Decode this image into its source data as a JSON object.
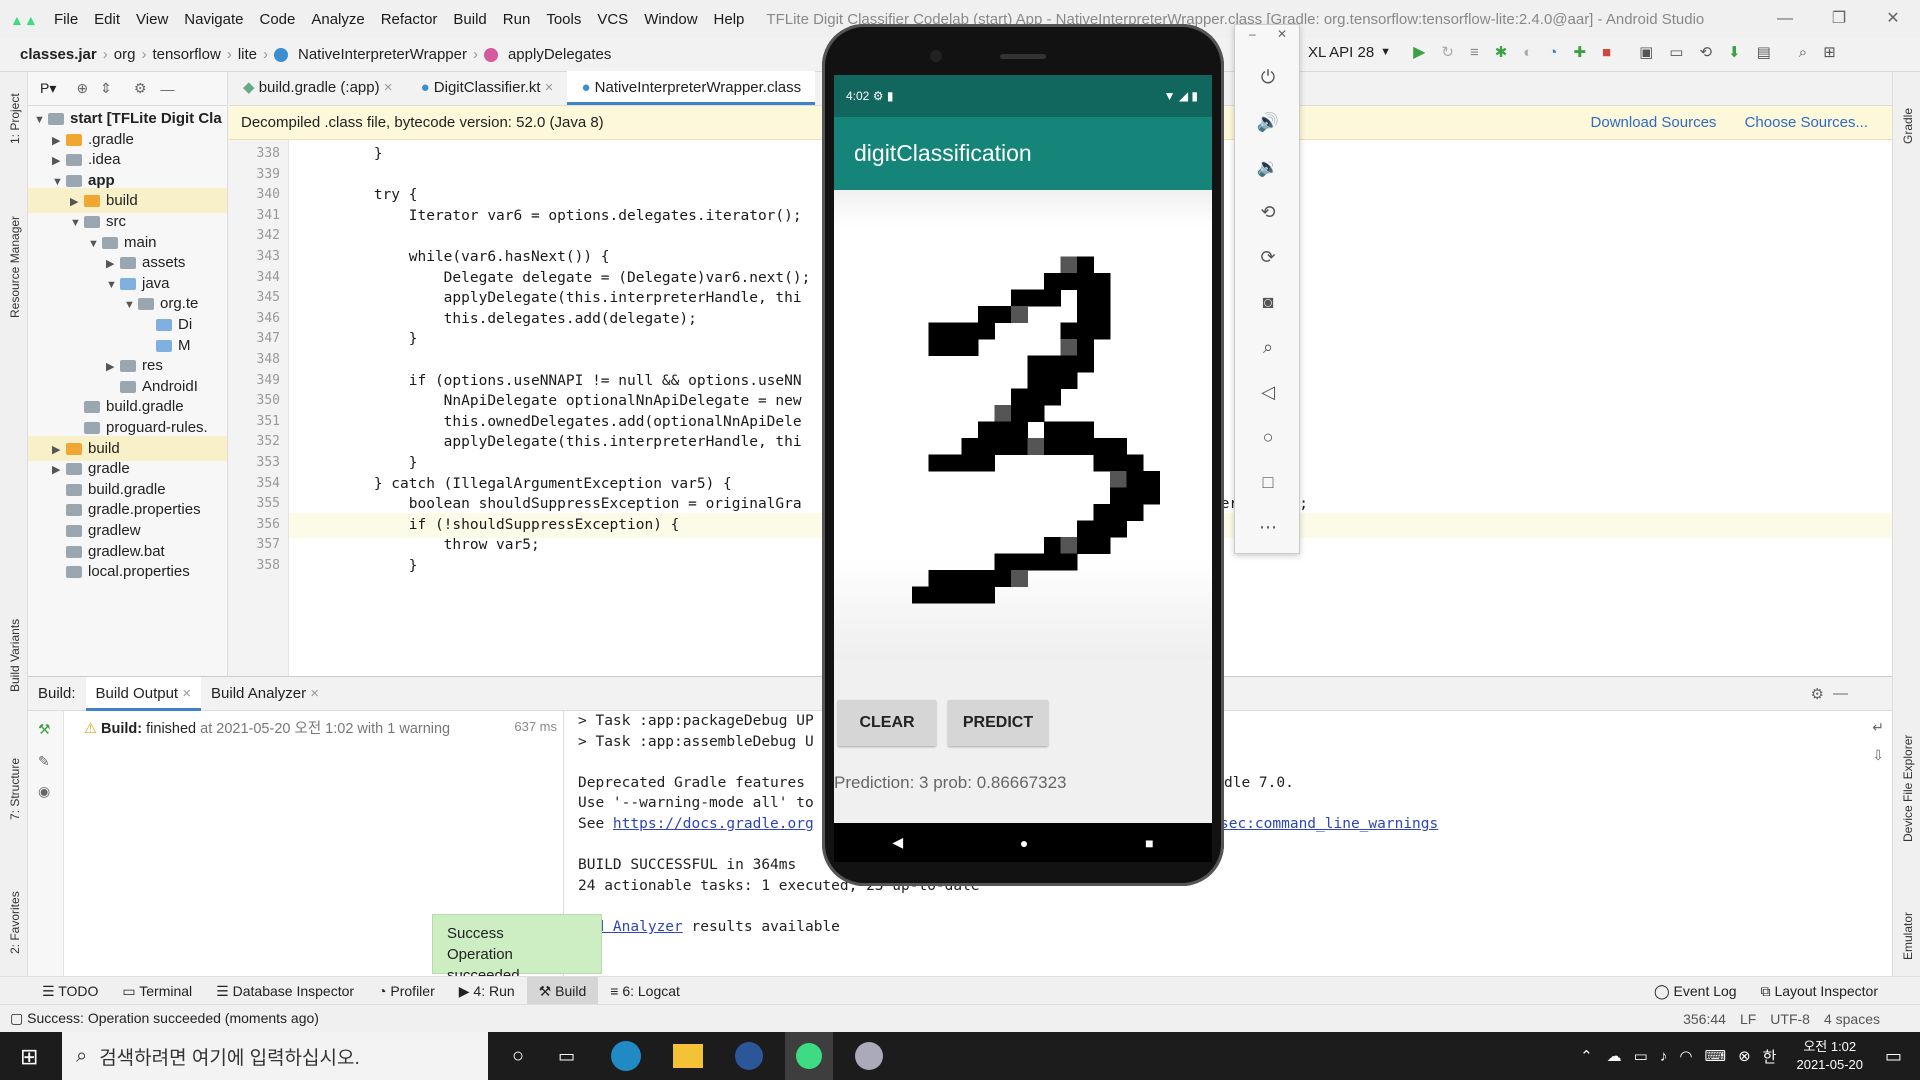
{
  "menu": [
    "File",
    "Edit",
    "View",
    "Navigate",
    "Code",
    "Analyze",
    "Refactor",
    "Build",
    "Run",
    "Tools",
    "VCS",
    "Window",
    "Help"
  ],
  "window_title": "TFLite Digit Classifier Codelab (start) App - NativeInterpreterWrapper.class [Gradle: org.tensorflow:tensorflow-lite:2.4.0@aar] - Android Studio",
  "breadcrumb": [
    "classes.jar",
    "org",
    "tensorflow",
    "lite",
    "NativeInterpreterWrapper",
    "applyDelegates"
  ],
  "device_selector": "XL API 28",
  "left_stripe": [
    "1: Project",
    "Resource Manager",
    "Build Variants",
    "7: Structure",
    "2: Favorites"
  ],
  "right_stripe": [
    "Gradle",
    "Device File Explorer",
    "Emulator"
  ],
  "project": {
    "header": "P▾",
    "items": [
      {
        "label": "start [TFLite Digit Cla",
        "depth": 0,
        "arrow": "▼",
        "icon": "folder",
        "sel": false,
        "bold": true
      },
      {
        "label": ".gradle",
        "depth": 1,
        "arrow": "▶",
        "icon": "orange",
        "sel": false
      },
      {
        "label": ".idea",
        "depth": 1,
        "arrow": "▶",
        "icon": "folder",
        "sel": false
      },
      {
        "label": "app",
        "depth": 1,
        "arrow": "▼",
        "icon": "folder",
        "sel": false,
        "bold": true
      },
      {
        "label": "build",
        "depth": 2,
        "arrow": "▶",
        "icon": "orange",
        "sel": true
      },
      {
        "label": "src",
        "depth": 2,
        "arrow": "▼",
        "icon": "folder",
        "sel": false
      },
      {
        "label": "main",
        "depth": 3,
        "arrow": "▼",
        "icon": "folder",
        "sel": false
      },
      {
        "label": "assets",
        "depth": 4,
        "arrow": "▶",
        "icon": "folder",
        "sel": false
      },
      {
        "label": "java",
        "depth": 4,
        "arrow": "▼",
        "icon": "blue",
        "sel": false
      },
      {
        "label": "org.te",
        "depth": 5,
        "arrow": "▼",
        "icon": "folder",
        "sel": false
      },
      {
        "label": "Di",
        "depth": 6,
        "arrow": "",
        "icon": "blue",
        "sel": false
      },
      {
        "label": "M",
        "depth": 6,
        "arrow": "",
        "icon": "blue",
        "sel": false
      },
      {
        "label": "res",
        "depth": 4,
        "arrow": "▶",
        "icon": "folder",
        "sel": false
      },
      {
        "label": "AndroidI",
        "depth": 4,
        "arrow": "",
        "icon": "folder",
        "sel": false
      },
      {
        "label": "build.gradle",
        "depth": 2,
        "arrow": "",
        "icon": "folder",
        "sel": false
      },
      {
        "label": "proguard-rules.",
        "depth": 2,
        "arrow": "",
        "icon": "folder",
        "sel": false
      },
      {
        "label": "build",
        "depth": 1,
        "arrow": "▶",
        "icon": "orange",
        "sel": true
      },
      {
        "label": "gradle",
        "depth": 1,
        "arrow": "▶",
        "icon": "folder",
        "sel": false
      },
      {
        "label": "build.gradle",
        "depth": 1,
        "arrow": "",
        "icon": "folder",
        "sel": false
      },
      {
        "label": "gradle.properties",
        "depth": 1,
        "arrow": "",
        "icon": "folder",
        "sel": false
      },
      {
        "label": "gradlew",
        "depth": 1,
        "arrow": "",
        "icon": "folder",
        "sel": false
      },
      {
        "label": "gradlew.bat",
        "depth": 1,
        "arrow": "",
        "icon": "folder",
        "sel": false
      },
      {
        "label": "local.properties",
        "depth": 1,
        "arrow": "",
        "icon": "folder",
        "sel": false
      }
    ]
  },
  "tabs": [
    "build.gradle (:app)",
    "DigitClassifier.kt",
    "NativeInterpreterWrapper.class"
  ],
  "decompiled_notice": "Decompiled .class file, bytecode version: 52.0 (Java 8)",
  "decompiled_links": [
    "Download Sources",
    "Choose Sources..."
  ],
  "code_lines": [
    {
      "n": "338",
      "t": "        }"
    },
    {
      "n": "339",
      "t": ""
    },
    {
      "n": "340",
      "t": "        try {"
    },
    {
      "n": "341",
      "t": "            Iterator var6 = options.delegates.iterator();"
    },
    {
      "n": "342",
      "t": ""
    },
    {
      "n": "343",
      "t": "            while(var6.hasNext()) {"
    },
    {
      "n": "344",
      "t": "                Delegate delegate = (Delegate)var6.next();"
    },
    {
      "n": "345",
      "t": "                applyDelegate(this.interpreterHandle, thi"
    },
    {
      "n": "346",
      "t": "                this.delegates.add(delegate);"
    },
    {
      "n": "347",
      "t": "            }"
    },
    {
      "n": "348",
      "t": ""
    },
    {
      "n": "349",
      "t": "            if (options.useNNAPI != null && options.useNN"
    },
    {
      "n": "350",
      "t": "                NnApiDelegate optionalNnApiDelegate = new"
    },
    {
      "n": "351",
      "t": "                this.ownedDelegates.add(optionalNnApiDele"
    },
    {
      "n": "352",
      "t": "                applyDelegate(this.interpreterHandle, thi                                      ));"
    },
    {
      "n": "353",
      "t": "            }"
    },
    {
      "n": "354",
      "t": "        } catch (IllegalArgumentException var5) {"
    },
    {
      "n": "355",
      "t": "            boolean shouldSuppressException = originalGra                                 (this.interpreterHandle);"
    },
    {
      "n": "356",
      "t": "            if (!shouldSuppressException) {"
    },
    {
      "n": "357",
      "t": "                throw var5;"
    },
    {
      "n": "358",
      "t": "            }"
    }
  ],
  "build": {
    "label": "Build:",
    "tabs": [
      "Build Output",
      "Build Analyzer"
    ],
    "status_prefix": "Build:",
    "status_text": "finished",
    "status_detail": "at 2021-05-20 오전 1:02 with 1 warning",
    "duration": "637 ms",
    "output_lines": [
      "> Task :app:packageDebug UP",
      "> Task :app:assembleDebug U",
      "",
      "Deprecated Gradle features                                     le with Gradle 7.0.",
      "Use '--warning-mode all' to",
      "See ",
      "",
      "BUILD SUCCESSFUL in 364ms",
      "24 actionable tasks: 1 executed, 23 up-to-date",
      "",
      "    ild Analyzer results available"
    ],
    "link1": "https://docs.gradle.org",
    "link2": "sec:command_line_warnings",
    "link3": "ild Analyzer"
  },
  "toolwindows": [
    "TODO",
    "Terminal",
    "Database Inspector",
    "Profiler",
    "4: Run",
    "Build",
    "6: Logcat"
  ],
  "toolwindows_right": [
    "Event Log",
    "Layout Inspector"
  ],
  "status": {
    "message": "Success: Operation succeeded (moments ago)",
    "position": "356:44",
    "line_sep": "LF",
    "encoding": "UTF-8",
    "indent": "4 spaces"
  },
  "toast": {
    "title": "Success",
    "body": "Operation succeeded"
  },
  "taskbar": {
    "search_placeholder": "검색하려면 여기에 입력하십시오.",
    "time": "오전 1:02",
    "date": "2021-05-20",
    "lang": "한"
  },
  "phone": {
    "time": "4:02",
    "app_title": "digitClassification",
    "clear_label": "CLEAR",
    "predict_label": "PREDICT",
    "prediction": "Prediction: 3 prob: 0.86667323"
  },
  "colors": {
    "teal_dark": "#11665e",
    "teal": "#15857a",
    "accent": "#4083c9",
    "toast": "#cdeec3"
  }
}
